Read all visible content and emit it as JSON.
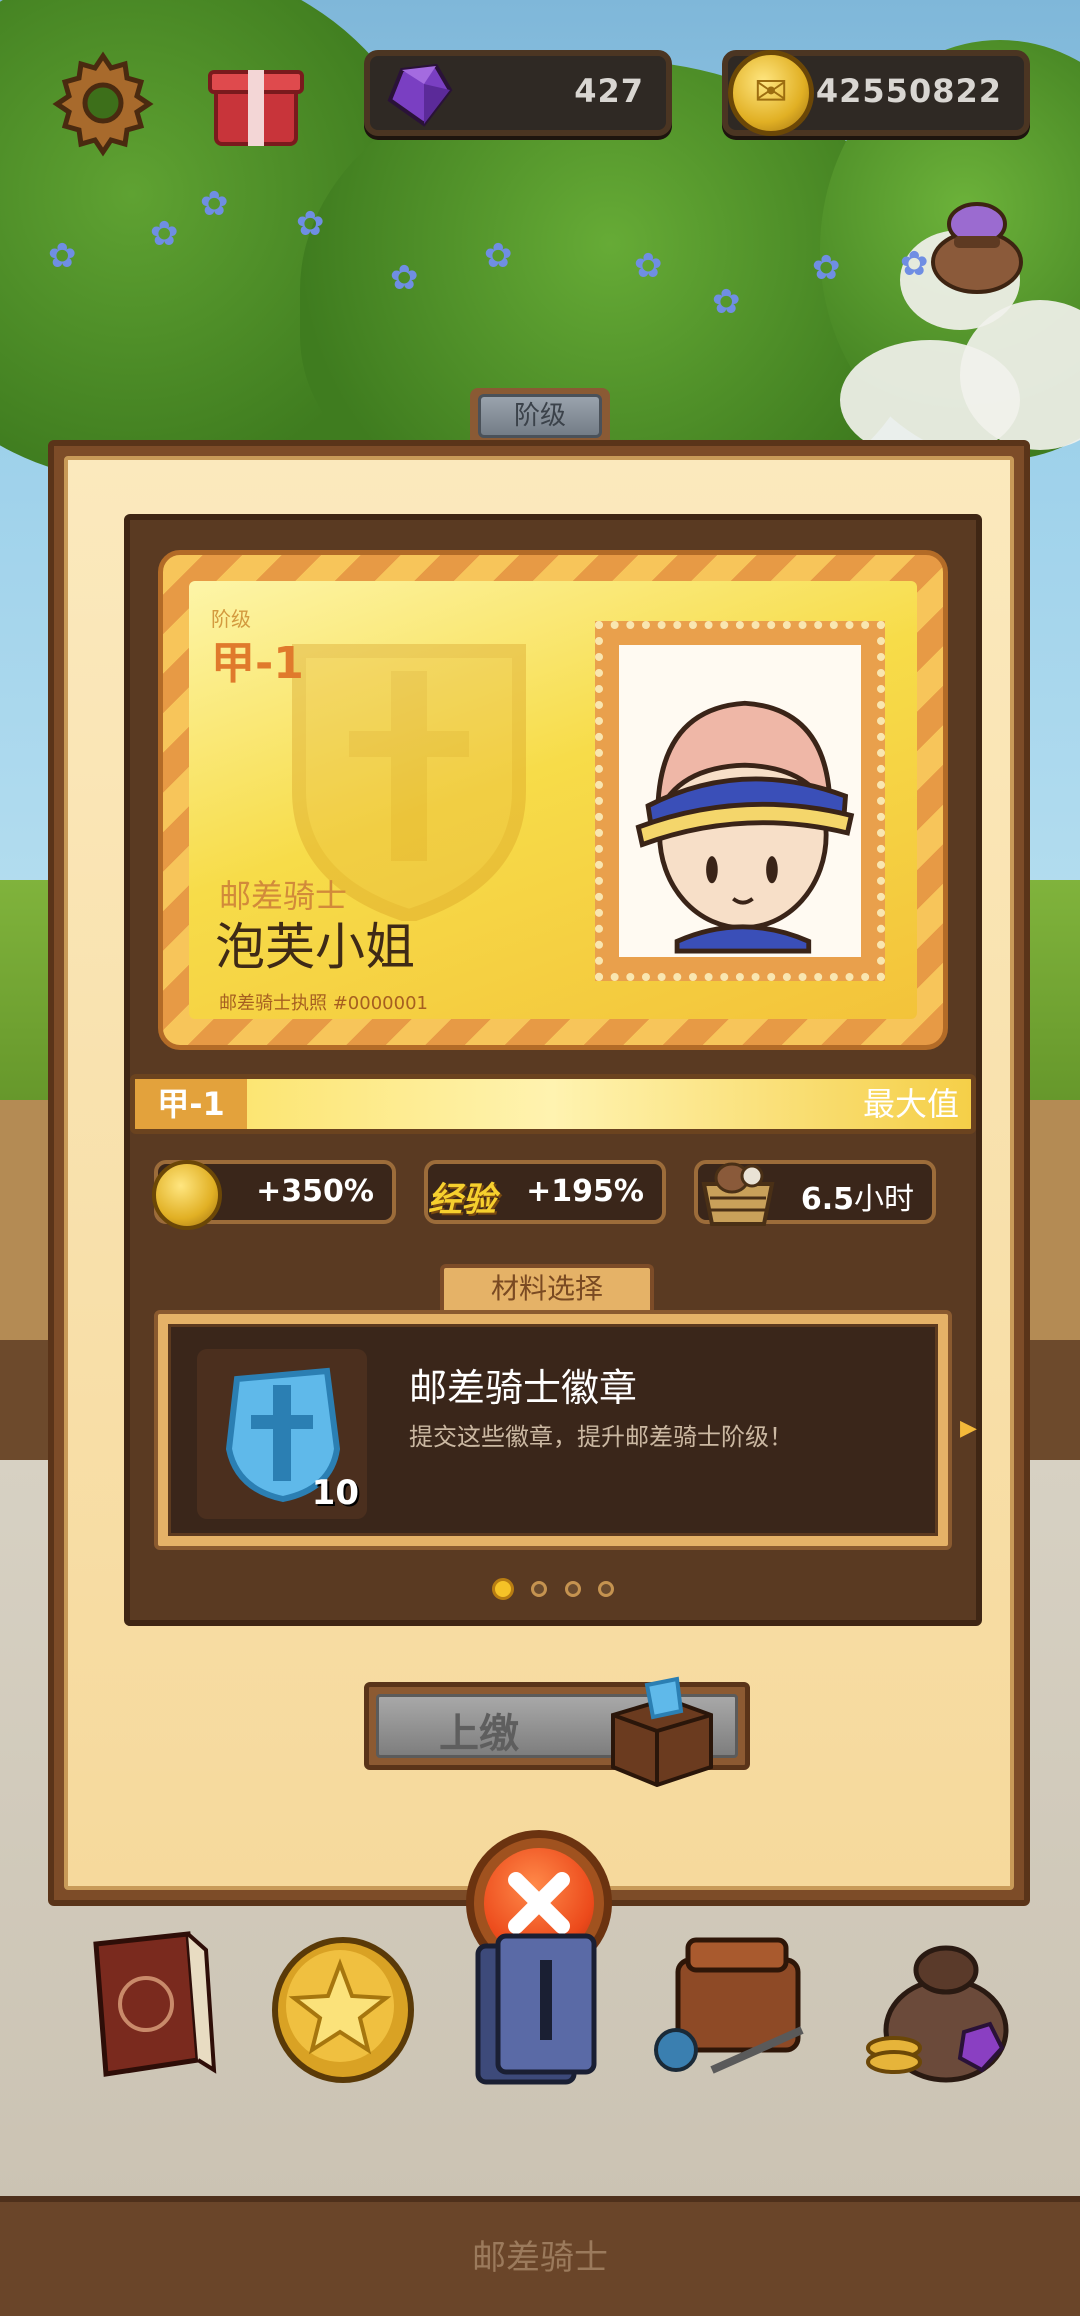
{
  "hud": {
    "gems": "427",
    "coins": "42550822",
    "icons": [
      "gear-icon",
      "gift-icon",
      "gem-icon",
      "coin-icon",
      "bag-icon"
    ]
  },
  "dialog": {
    "tab_label": "阶级",
    "card": {
      "rank_label": "阶级",
      "rank_value": "甲-1",
      "title": "邮差骑士",
      "name": "泡芙小姐",
      "license_number": "邮差骑士执照 #0000001"
    },
    "progress": {
      "left_label": "甲-1",
      "right_label": "最大值",
      "fill": 1.0
    },
    "bonuses": [
      {
        "icon": "coin-icon",
        "value": "+350%"
      },
      {
        "badge": "经验",
        "value": "+195%"
      },
      {
        "icon": "crate-icon",
        "value_num": "6.5",
        "value_unit": "小时"
      }
    ],
    "material": {
      "tab_label": "材料选择",
      "title": "邮差骑士徽章",
      "description": "提交这些徽章，提升邮差骑士阶级！",
      "count": "10",
      "page": 1,
      "pages": 4
    },
    "submit_label": "上缴"
  },
  "nav": {
    "items": [
      "book-icon",
      "star-coin-icon",
      "cards-icon",
      "backpack-icon",
      "loot-bag-icon"
    ]
  },
  "footer": {
    "title": "邮差骑士"
  },
  "colors": {
    "wood": "#7d4c28",
    "parchment": "#fbe9bd",
    "gold": "#f5c227",
    "close": "#ec4a1b"
  }
}
